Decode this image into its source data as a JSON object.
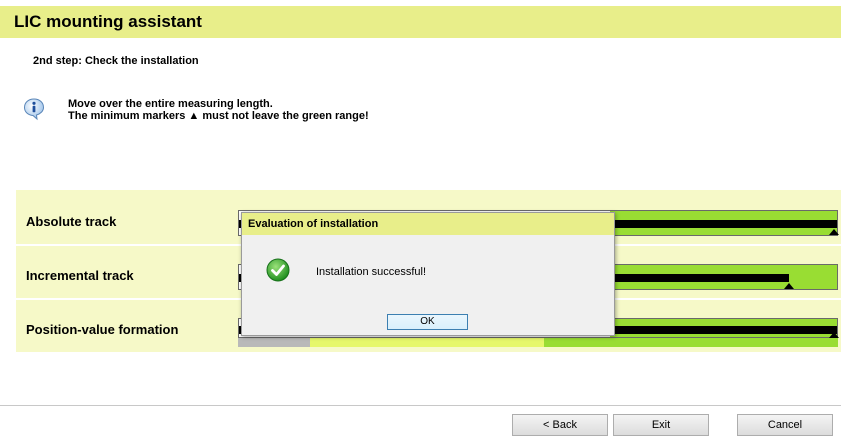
{
  "app": {
    "title": "LIC mounting assistant"
  },
  "step": {
    "label": "2nd step: Check the installation"
  },
  "info": {
    "icon": "info-icon",
    "line1": "Move over the entire measuring length.",
    "line2": "The minimum markers ▲ must not leave the green range!"
  },
  "tracks": [
    {
      "label": "Absolute track",
      "fill_fraction": 1.0,
      "marker": 0.995
    },
    {
      "label": "Incremental track",
      "fill_fraction": 0.92,
      "marker": 0.92
    },
    {
      "label": "Position-value formation",
      "fill_fraction": 1.0,
      "marker": 0.995
    }
  ],
  "range_strip": {
    "gray_to": 0.12,
    "yellow_to": 0.51,
    "colors": {
      "gray": "#b9b9b9",
      "yellow": "#e6f76a",
      "green": "#99dd33"
    }
  },
  "dialog": {
    "title": "Evaluation of installation",
    "icon": "success-check-icon",
    "message": "Installation successful!",
    "ok_label": "OK"
  },
  "footer": {
    "back_label": "< Back",
    "exit_label": "Exit",
    "cancel_label": "Cancel"
  },
  "colors": {
    "accent_yellow": "#e8ee8a",
    "panel_bg": "#f6f9c8",
    "green_range": "#99dd33"
  }
}
